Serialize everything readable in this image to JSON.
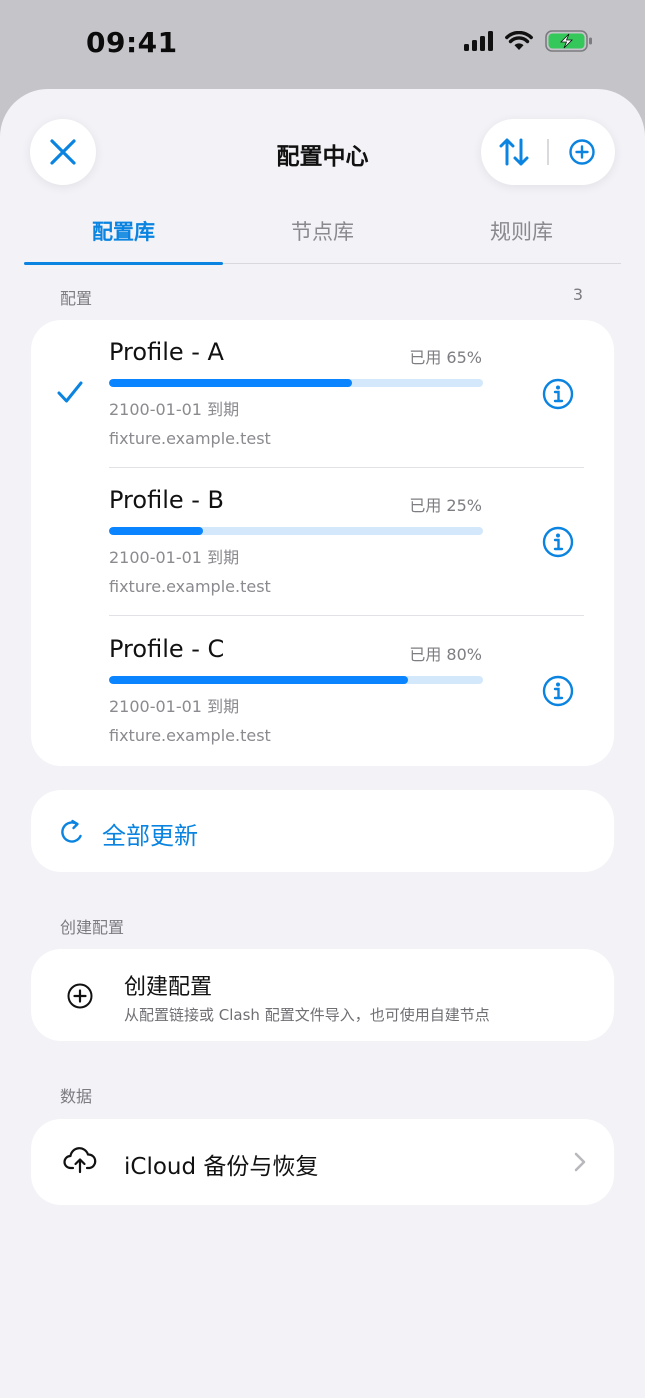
{
  "status_bar": {
    "time": "09:41"
  },
  "header": {
    "title": "配置中心"
  },
  "tabs": [
    {
      "label": "配置库",
      "active": true
    },
    {
      "label": "节点库",
      "active": false
    },
    {
      "label": "规则库",
      "active": false
    }
  ],
  "profiles_section": {
    "label": "配置",
    "count": "3",
    "items": [
      {
        "name": "Profile - A",
        "used_label": "已用 65%",
        "used_fraction": 0.65,
        "expire": "2100-01-01 到期",
        "host": "fixture.example.test",
        "selected": true
      },
      {
        "name": "Profile - B",
        "used_label": "已用 25%",
        "used_fraction": 0.25,
        "expire": "2100-01-01 到期",
        "host": "fixture.example.test",
        "selected": false
      },
      {
        "name": "Profile - C",
        "used_label": "已用 80%",
        "used_fraction": 0.8,
        "expire": "2100-01-01 到期",
        "host": "fixture.example.test",
        "selected": false
      }
    ]
  },
  "update_all": {
    "label": "全部更新"
  },
  "create_section": {
    "label": "创建配置",
    "title": "创建配置",
    "subtitle": "从配置链接或 Clash 配置文件导入，也可使用自建节点"
  },
  "data_section": {
    "label": "数据",
    "icloud_label": "iCloud 备份与恢复"
  },
  "colors": {
    "accent": "#0a84e0",
    "bar_fill": "#0a84ff",
    "bar_track": "#d3e8fb",
    "battery": "#34c759"
  },
  "icons": [
    "close-icon",
    "sort-icon",
    "add-circle-icon",
    "checkmark-icon",
    "info-icon",
    "refresh-icon",
    "plus-circle-icon",
    "cloud-upload-icon",
    "chevron-right-icon"
  ]
}
